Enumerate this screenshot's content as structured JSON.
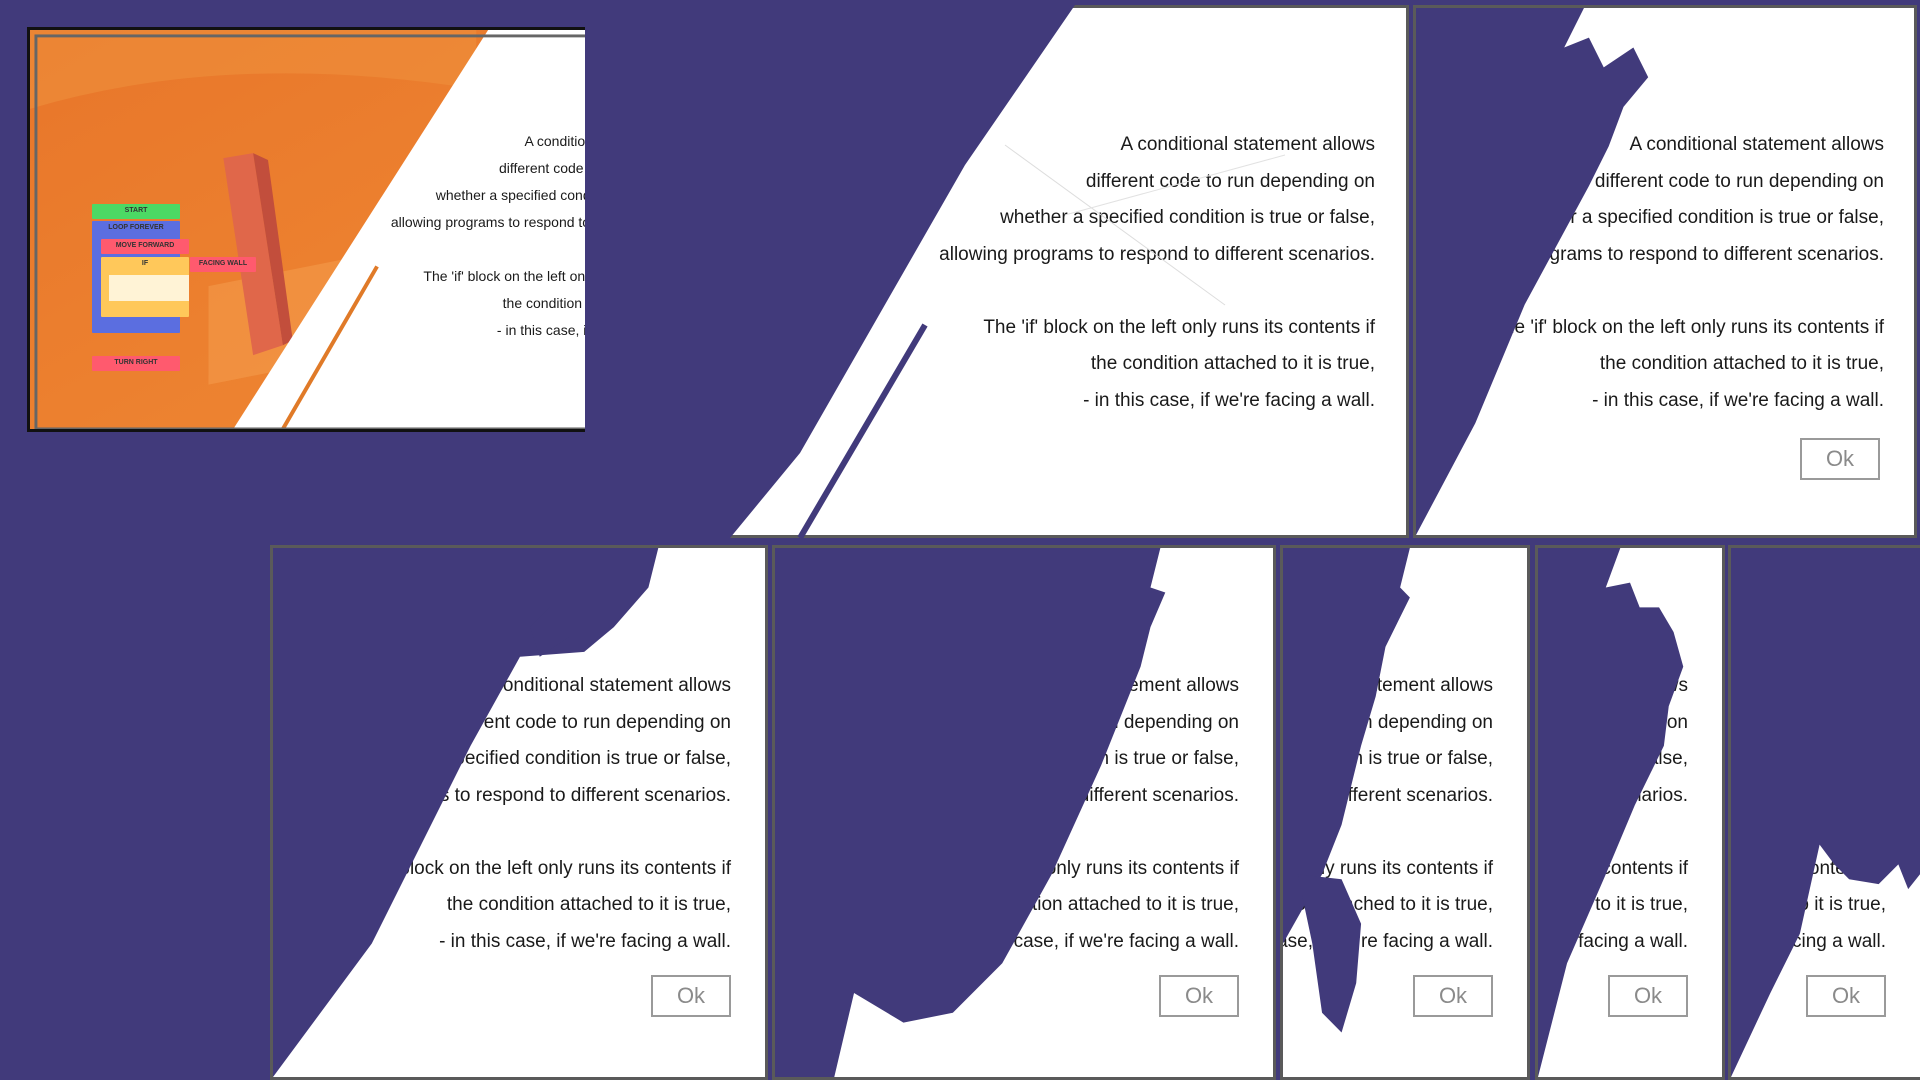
{
  "dialog": {
    "paragraph1": [
      "A conditional statement allows",
      "different code to run depending on",
      "whether a specified condition is true or false,",
      "allowing programs to respond to different scenarios."
    ],
    "paragraph2": [
      "The 'if' block on the left only runs its contents if",
      "the condition attached to it is true,",
      "- in this case, if we're facing a wall."
    ],
    "ok_label": "Ok"
  },
  "code_blocks": {
    "start": "START",
    "loop": "LOOP FOREVER",
    "move": "MOVE FORWARD",
    "if": "IF",
    "condition": "FACING WALL",
    "turn": "TURN RIGHT"
  },
  "colors": {
    "background": "#413a7b",
    "panel": "#ffffff",
    "scene_orange": "#e8782a",
    "start_block": "#4cd964",
    "loop_block": "#5b6ee0",
    "move_block": "#ff5a6e",
    "if_block": "#ffc85a",
    "condition_block": "#ff5a6e",
    "turn_block": "#ff5a6e"
  }
}
